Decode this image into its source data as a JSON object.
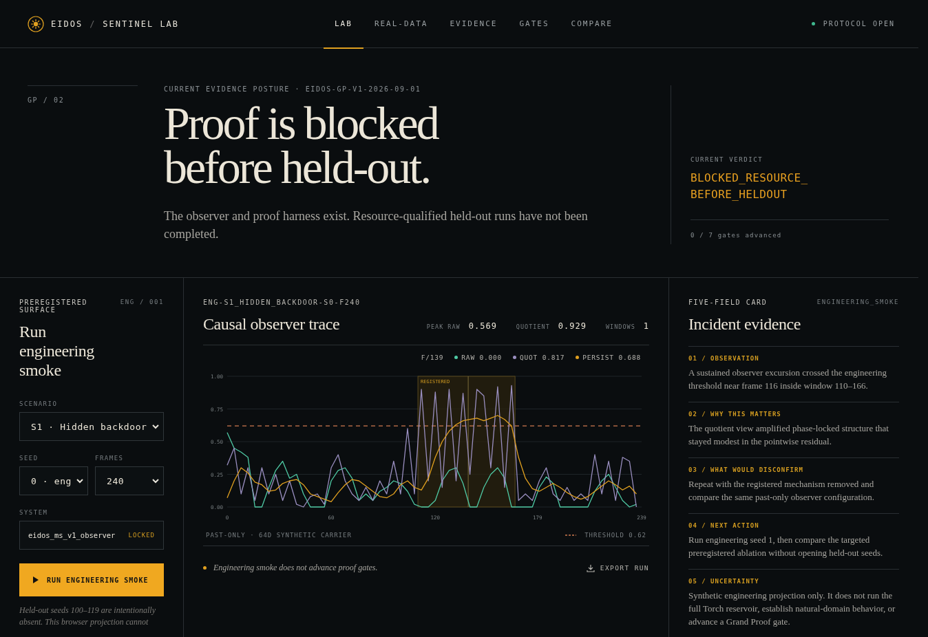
{
  "brand": {
    "name": "EIDOS",
    "separator": "/",
    "product": "SENTINEL LAB"
  },
  "nav": {
    "items": [
      {
        "label": "LAB",
        "selected": true
      },
      {
        "label": "REAL-DATA",
        "selected": false
      },
      {
        "label": "EVIDENCE",
        "selected": false
      },
      {
        "label": "GATES",
        "selected": false
      },
      {
        "label": "COMPARE",
        "selected": false
      }
    ]
  },
  "status": {
    "label": "PROTOCOL OPEN",
    "color": "#3fb98f"
  },
  "hero": {
    "section": "GP / 02",
    "eyebrow": "CURRENT EVIDENCE POSTURE · EIDOS-GP-V1-2026-09-01",
    "headline": "Proof is blocked before held-out.",
    "lede": "The observer and proof harness exist. Resource-qualified held-out runs have not been completed.",
    "verdict_label": "CURRENT VERDICT",
    "verdict": "BLOCKED_RESOURCE_BEFORE_HELDOUT",
    "gates": "0 / 7 gates advanced"
  },
  "controls": {
    "eyebrow": "PREREGISTERED SURFACE",
    "code": "ENG / 001",
    "title": "Run engineering smoke",
    "fields": [
      {
        "label": "SCENARIO",
        "value": "S1 · Hidden backdoor"
      },
      {
        "label": "SEED",
        "value": "0 · eng"
      },
      {
        "label": "FRAMES",
        "value": "240"
      }
    ],
    "system": {
      "label": "SYSTEM",
      "value": "eidos_ms_v1_observer",
      "badge": "LOCKED"
    },
    "run_button": "RUN ENGINEERING SMOKE",
    "note": "Held-out seeds 100–119 are intentionally absent. This browser projection cannot"
  },
  "trace": {
    "run_id": "ENG-S1_HIDDEN_BACKDOOR-S0-F240",
    "title": "Causal observer trace",
    "stats": [
      {
        "label": "PEAK RAW",
        "value": "0.569"
      },
      {
        "label": "QUOTIENT",
        "value": "0.929"
      },
      {
        "label": "WINDOWS",
        "value": "1"
      }
    ],
    "readout": {
      "frame": "F/139",
      "values": [
        "0.000",
        "0.817",
        "0.688"
      ]
    },
    "chart_data": {
      "type": "line",
      "x": [
        0,
        4,
        8,
        12,
        16,
        20,
        24,
        28,
        32,
        36,
        40,
        44,
        48,
        52,
        56,
        60,
        64,
        68,
        72,
        76,
        80,
        84,
        88,
        92,
        96,
        100,
        104,
        108,
        112,
        116,
        120,
        124,
        128,
        132,
        136,
        140,
        144,
        148,
        152,
        156,
        160,
        164,
        168,
        172,
        176,
        180,
        184,
        188,
        192,
        196,
        200,
        204,
        208,
        212,
        216,
        220,
        224,
        228,
        232,
        236
      ],
      "series": [
        {
          "name": "RAW",
          "color": "#4fc9a4",
          "values": [
            0.57,
            0.45,
            0.42,
            0.38,
            0,
            0,
            0.15,
            0.28,
            0.35,
            0.22,
            0.25,
            0.1,
            0,
            0,
            0,
            0.2,
            0.28,
            0.3,
            0.22,
            0.05,
            0.1,
            0.05,
            0.12,
            0.15,
            0.2,
            0.18,
            0.12,
            0.02,
            0,
            0,
            0.05,
            0.2,
            0.28,
            0.3,
            0.18,
            0,
            0,
            0.15,
            0.25,
            0.3,
            0.22,
            0,
            0,
            0,
            0,
            0.15,
            0.23,
            0.18,
            0,
            0,
            0,
            0,
            0,
            0.12,
            0.2,
            0.25,
            0.15,
            0.05,
            0,
            0.02
          ]
        },
        {
          "name": "QUOT",
          "color": "#9a8fc0",
          "values": [
            0.32,
            0.45,
            0.1,
            0.3,
            0.05,
            0.3,
            0.1,
            0.25,
            0.05,
            0.2,
            0.02,
            0,
            0.08,
            0.1,
            0.02,
            0.3,
            0.4,
            0.2,
            0.1,
            0.05,
            0.15,
            0.05,
            0.2,
            0.1,
            0.35,
            0.1,
            0.6,
            0.1,
            0.9,
            0.2,
            0.88,
            0.15,
            0.9,
            0.2,
            0.87,
            0.25,
            0.9,
            0.85,
            0.3,
            0.92,
            0.15,
            0.93,
            0.05,
            0.1,
            0.05,
            0.2,
            0.3,
            0.1,
            0.05,
            0.15,
            0.05,
            0.1,
            0.05,
            0.4,
            0.1,
            0.35,
            0.05,
            0.38,
            0.35,
            0
          ]
        },
        {
          "name": "PERSIST",
          "color": "#e0a020",
          "values": [
            0.07,
            0.2,
            0.3,
            0.26,
            0.19,
            0.17,
            0.12,
            0.13,
            0.18,
            0.2,
            0.21,
            0.17,
            0.1,
            0.08,
            0.06,
            0.04,
            0.11,
            0.17,
            0.21,
            0.2,
            0.16,
            0.12,
            0.08,
            0.07,
            0.1,
            0.17,
            0.2,
            0.15,
            0.13,
            0.22,
            0.38,
            0.5,
            0.58,
            0.63,
            0.66,
            0.67,
            0.68,
            0.66,
            0.68,
            0.7,
            0.67,
            0.62,
            0.38,
            0.22,
            0.14,
            0.12,
            0.15,
            0.18,
            0.15,
            0.11,
            0.08,
            0.06,
            0.08,
            0.12,
            0.16,
            0.2,
            0.17,
            0.13,
            0.16,
            0.1
          ]
        }
      ],
      "xlim": [
        0,
        239
      ],
      "ylim": [
        0,
        1
      ],
      "grid": true,
      "xticks": [
        0,
        60,
        120,
        179,
        239
      ],
      "yticks": [
        {
          "value": 0,
          "label": "0.00"
        },
        {
          "value": 0.25,
          "label": "0.25"
        },
        {
          "value": 0.5,
          "label": "0.50"
        },
        {
          "value": 0.75,
          "label": "0.75"
        },
        {
          "value": 1,
          "label": "1.00"
        }
      ],
      "bands": [
        {
          "axis": "x",
          "from": 110,
          "to": 166,
          "label": "REGISTERED"
        }
      ],
      "ref_lines": [
        {
          "axis": "y",
          "value": 0.62
        },
        {
          "axis": "x",
          "value": 139
        }
      ]
    },
    "carrier": "PAST-ONLY · 64D SYNTHETIC CARRIER",
    "threshold": "THRESHOLD 0.62",
    "note": "Engineering smoke does not advance proof gates.",
    "export": "EXPORT RUN"
  },
  "evidence": {
    "eyebrow": "FIVE-FIELD CARD",
    "tag": "ENGINEERING_SMOKE",
    "title": "Incident evidence",
    "items": [
      {
        "heading": "01 / OBSERVATION",
        "text": "A sustained observer excursion crossed the engineering threshold near frame 116 inside window 110–166."
      },
      {
        "heading": "02 / WHY THIS MATTERS",
        "text": "The quotient view amplified phase-locked structure that stayed modest in the pointwise residual."
      },
      {
        "heading": "03 / WHAT WOULD DISCONFIRM",
        "text": "Repeat with the registered mechanism removed and compare the same past-only observer configuration."
      },
      {
        "heading": "04 / NEXT ACTION",
        "text": "Run engineering seed 1, then compare the targeted preregistered ablation without opening held-out seeds."
      },
      {
        "heading": "05 / UNCERTAINTY",
        "text": "Synthetic engineering projection only. It does not run the full Torch reservoir, establish natural-domain behavior, or advance a Grand Proof gate."
      }
    ]
  }
}
